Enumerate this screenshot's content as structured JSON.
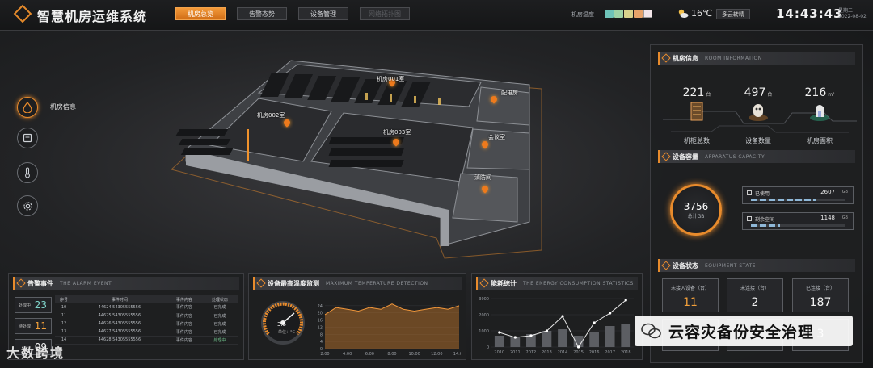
{
  "header": {
    "app_title": "智慧机房运维系统",
    "tabs": [
      {
        "label": "机房总览",
        "active": true
      },
      {
        "label": "告警态势",
        "active": false
      },
      {
        "label": "设备管理",
        "active": false
      },
      {
        "label": "网络拓扑图",
        "active": false
      }
    ],
    "temp_label": "机房温度",
    "temp_scale_colors": [
      "#6ec3b8",
      "#9fd3a6",
      "#d8d28c",
      "#e7a36a",
      "#f3e6ea"
    ],
    "weather_icon": "partly-cloudy-icon",
    "temperature": "16℃",
    "weather_desc": "多云转晴",
    "clock": "14:43:43",
    "weekday": "星期二",
    "date": "2022-08-02"
  },
  "side_nav": {
    "items": [
      {
        "icon": "drop-icon",
        "label": "机房信息",
        "active": true
      },
      {
        "icon": "cabinet-icon",
        "label": "",
        "active": false
      },
      {
        "icon": "thermometer-icon",
        "label": "",
        "active": false
      },
      {
        "icon": "gear-icon",
        "label": "",
        "active": false
      }
    ]
  },
  "floor_plan": {
    "rooms": [
      {
        "label": "机房001室"
      },
      {
        "label": "机房002室"
      },
      {
        "label": "机房003室"
      },
      {
        "label": "配电房"
      },
      {
        "label": "会议室"
      },
      {
        "label": "消防间"
      }
    ]
  },
  "room_info": {
    "title": "机房信息",
    "title_en": "ROOM INFORMATION",
    "stats": [
      {
        "value": "221",
        "unit": "台",
        "label": "机柜总数"
      },
      {
        "value": "497",
        "unit": "台",
        "label": "设备数量"
      },
      {
        "value": "216",
        "unit": "m²",
        "label": "机房面积"
      }
    ]
  },
  "capacity": {
    "title": "设备容量",
    "title_en": "APPARATUS CAPACITY",
    "total": "3756",
    "total_label": "总计GB",
    "used_label": "已使用",
    "used_value": "2607",
    "used_unit": "GB",
    "used_fraction": 0.69,
    "free_label": "剩余空间",
    "free_value": "1148",
    "free_unit": "GB",
    "free_fraction": 0.31
  },
  "equipment_state": {
    "title": "设备状态",
    "title_en": "EQUIPMENT STATE",
    "boxes": [
      {
        "label": "未接入设备（台）",
        "value": "11",
        "highlight": true
      },
      {
        "label": "未连接（台）",
        "value": "2",
        "highlight": false
      },
      {
        "label": "已连接（台）",
        "value": "187",
        "highlight": false
      }
    ],
    "row2": [
      "0",
      "0",
      "3"
    ]
  },
  "alarm": {
    "title": "告警事件",
    "title_en": "THE ALARM EVENT",
    "cards": [
      {
        "label": "处理中",
        "value": "23",
        "color": "#7fd3c9"
      },
      {
        "label": "待处理",
        "value": "11",
        "color": "#f3a03a"
      },
      {
        "label": "",
        "value": "09",
        "color": "#f0f0f0"
      }
    ],
    "columns": [
      "序号",
      "事件时间",
      "事件内容",
      "处理状态"
    ],
    "rows": [
      [
        "10",
        "44624.54305555556",
        "事件内容",
        "已完成"
      ],
      [
        "11",
        "44625.54305555556",
        "事件内容",
        "已完成"
      ],
      [
        "12",
        "44626.54305555556",
        "事件内容",
        "已完成"
      ],
      [
        "13",
        "44627.54305555556",
        "事件内容",
        "已完成"
      ],
      [
        "14",
        "44628.54305555556",
        "事件内容",
        "处理中"
      ]
    ]
  },
  "temperature_monitor": {
    "title": "设备最高温度监测",
    "title_en": "MAXIMUM TEMPERATURE DETECTION",
    "gauge_value": "3.5",
    "gauge_unit": "单位：°C"
  },
  "energy": {
    "title": "能耗统计",
    "title_en": "THE ENERGY CONSUMPTION STATISTICS"
  },
  "chart_data": [
    {
      "type": "area",
      "x": [
        "2:00",
        "4:00",
        "6:00",
        "8:00",
        "10:00",
        "12:00",
        "14:00"
      ],
      "series": [
        {
          "values": [
            19,
            23,
            22,
            21,
            23,
            22,
            25,
            22,
            21,
            22,
            23,
            22,
            24
          ]
        }
      ],
      "yticks": [
        0,
        4,
        8,
        12,
        16,
        20,
        24
      ],
      "ylim": [
        0,
        28
      ]
    },
    {
      "type": "bar",
      "categories": [
        "2010",
        "2011",
        "2012",
        "2013",
        "2014",
        "2015",
        "2016",
        "2017",
        "2018"
      ],
      "values": [
        700,
        650,
        800,
        1000,
        1100,
        700,
        900,
        1300,
        1400
      ],
      "line_values": [
        900,
        600,
        700,
        1000,
        1900,
        0,
        1500,
        2100,
        2900
      ],
      "yticks": [
        0,
        1000,
        2000,
        3000
      ],
      "ylim": [
        0,
        3000
      ]
    }
  ],
  "watermark": {
    "text": "云容灾备份安全治理",
    "bottom_text": "大数跨境"
  }
}
